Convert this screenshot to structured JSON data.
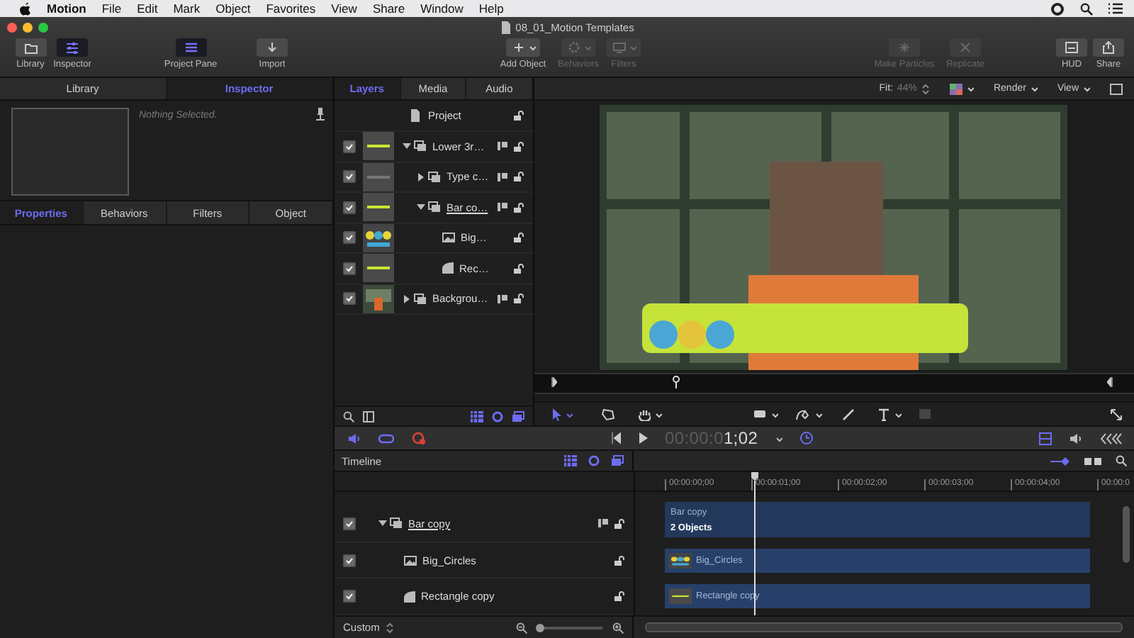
{
  "menubar": {
    "app": "Motion",
    "menus": [
      "File",
      "Edit",
      "Mark",
      "Object",
      "Favorites",
      "View",
      "Share",
      "Window",
      "Help"
    ]
  },
  "window": {
    "title": "08_01_Motion Templates"
  },
  "toolbar": {
    "groups": [
      {
        "items": [
          {
            "kind": "library",
            "label": "Library",
            "selected": false,
            "disabled": false,
            "dropdown": false
          },
          {
            "kind": "inspector",
            "label": "Inspector",
            "selected": true,
            "disabled": false,
            "dropdown": false
          }
        ]
      },
      {
        "items": [
          {
            "kind": "pane",
            "label": "Project Pane",
            "selected": true,
            "disabled": false,
            "dropdown": false
          }
        ]
      },
      {
        "items": [
          {
            "kind": "import",
            "label": "Import",
            "selected": false,
            "disabled": false,
            "dropdown": false
          }
        ]
      },
      {
        "items": [
          {
            "kind": "add",
            "label": "Add Object",
            "selected": false,
            "disabled": false,
            "dropdown": true
          },
          {
            "kind": "behaviors",
            "label": "Behaviors",
            "selected": false,
            "disabled": true,
            "dropdown": true
          },
          {
            "kind": "filters",
            "label": "Filters",
            "selected": false,
            "disabled": true,
            "dropdown": true
          }
        ]
      },
      {
        "items": [
          {
            "kind": "particles",
            "label": "Make Particles",
            "selected": false,
            "disabled": true,
            "dropdown": false
          },
          {
            "kind": "replicate",
            "label": "Replicate",
            "selected": false,
            "disabled": true,
            "dropdown": false
          }
        ]
      },
      {
        "items": [
          {
            "kind": "hud",
            "label": "HUD",
            "selected": false,
            "disabled": false,
            "dropdown": false
          },
          {
            "kind": "share",
            "label": "Share",
            "selected": false,
            "disabled": false,
            "dropdown": false
          }
        ]
      }
    ]
  },
  "inspector": {
    "tabs": [
      {
        "label": "Library",
        "selected": false
      },
      {
        "label": "Inspector",
        "selected": true
      }
    ],
    "message": "Nothing Selected.",
    "subtabs": [
      {
        "label": "Properties",
        "selected": true
      },
      {
        "label": "Behaviors",
        "selected": false
      },
      {
        "label": "Filters",
        "selected": false
      },
      {
        "label": "Object",
        "selected": false
      }
    ]
  },
  "layers": {
    "tabs": [
      {
        "label": "Layers",
        "selected": true
      },
      {
        "label": "Media",
        "selected": false
      },
      {
        "label": "Audio",
        "selected": false
      }
    ],
    "project": "Project",
    "items": [
      {
        "kind": "group",
        "name": "Lower 3r…",
        "thumbnail": {
          "kind": "bar"
        },
        "checked": true,
        "expanded": true,
        "underlined": false,
        "children": [
          {
            "kind": "group",
            "name": "Type c…",
            "thumbnail": {
              "kind": "text"
            },
            "checked": true,
            "expanded": false,
            "underlined": false
          },
          {
            "kind": "group",
            "name": "Bar co…",
            "thumbnail": {
              "kind": "bar"
            },
            "checked": true,
            "expanded": true,
            "underlined": true,
            "children": [
              {
                "kind": "image",
                "name": "Big…",
                "thumbnail": {
                  "kind": "circles"
                },
                "checked": true,
                "underlined": false
              },
              {
                "kind": "shape",
                "name": "Rec…",
                "thumbnail": {
                  "kind": "bar"
                },
                "checked": true,
                "underlined": false
              }
            ]
          }
        ]
      },
      {
        "kind": "group",
        "name": "Backgrou…",
        "thumbnail": {
          "kind": "photo"
        },
        "checked": true,
        "expanded": false,
        "underlined": false
      }
    ]
  },
  "viewer": {
    "fit_label": "Fit:",
    "fit": "44%",
    "render": "Render",
    "view": "View",
    "scrubber": {
      "level": 0.22
    }
  },
  "transport": {
    "timecode_dim": "00:00:0",
    "timecode": "1;02"
  },
  "timeline": {
    "title": "Timeline",
    "ruler": [
      "00:00:00;00",
      "00:00:01;00",
      "00:00:02;00",
      "00:00:03;00",
      "00:00:04;00",
      "00:00:0"
    ],
    "playhead": {
      "level": 0.21
    },
    "layers": [
      {
        "kind": "group",
        "name": "Bar copy",
        "checked": true,
        "expanded": true,
        "underlined": true,
        "children": [
          {
            "kind": "image",
            "name": "Big_Circles",
            "checked": true,
            "underlined": false
          },
          {
            "kind": "shape",
            "name": "Rectangle copy",
            "checked": true,
            "underlined": false
          }
        ]
      }
    ],
    "tracks": [
      {
        "kind": "group",
        "name": "Bar copy",
        "detail": "2 Objects"
      },
      {
        "kind": "image",
        "name": "Big_Circles",
        "thumbnail": {
          "kind": "circles"
        }
      },
      {
        "kind": "shape",
        "name": "Rectangle copy",
        "thumbnail": {
          "kind": "bar"
        }
      }
    ],
    "zoom": "Custom",
    "zoom_slider": {
      "level": 0.05
    }
  }
}
